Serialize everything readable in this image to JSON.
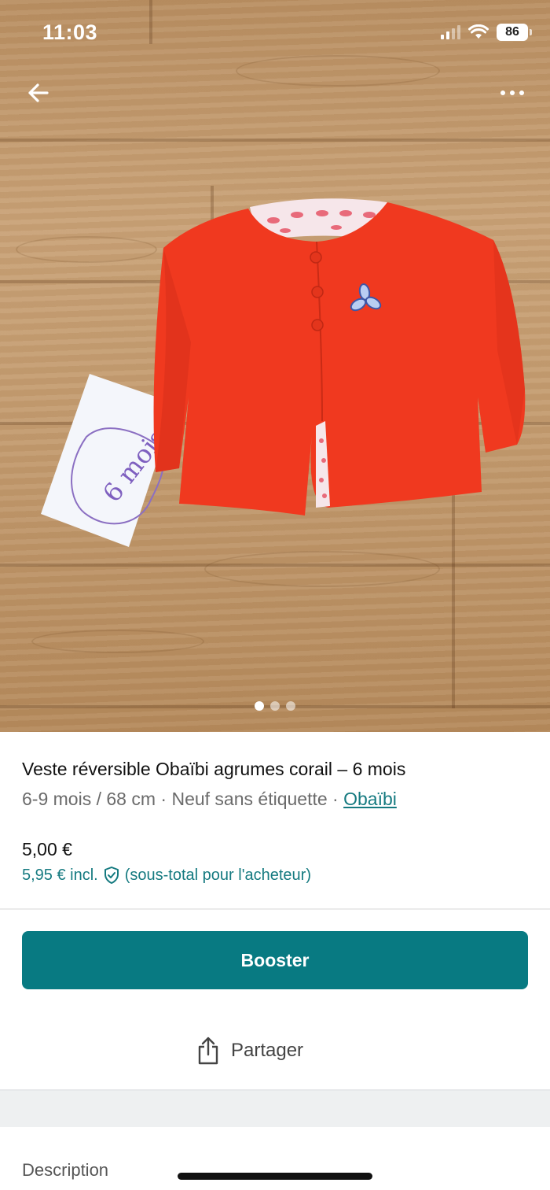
{
  "status_bar": {
    "time": "11:03",
    "battery": "86"
  },
  "photo": {
    "note_card_text": "6 mois",
    "carousel_count": 3,
    "carousel_active": 0
  },
  "listing": {
    "title": "Veste réversible Obaïbi agrumes corail – 6 mois",
    "size": "6-9 mois / 68 cm",
    "separator": " · ",
    "condition": "Neuf sans étiquette",
    "brand": "Obaïbi",
    "price": "5,00 €",
    "price_incl": "5,95 € incl.",
    "price_incl_note": "(sous-total pour l'acheteur)"
  },
  "actions": {
    "boost_label": "Booster",
    "share_label": "Partager"
  },
  "sections": {
    "description_label": "Description"
  },
  "colors": {
    "accent": "#087a82",
    "link": "#157a80",
    "jacket": "#f0391f"
  },
  "icons": {
    "back": "arrow-left-icon",
    "more": "more-dots-icon",
    "protection": "shield-check-icon",
    "share": "share-icon"
  }
}
